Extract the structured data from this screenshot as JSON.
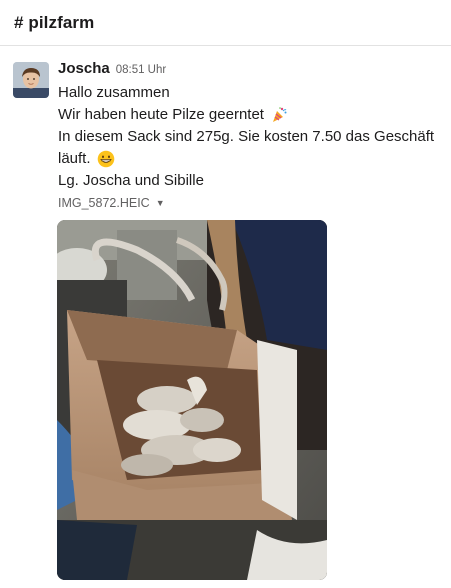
{
  "channel": {
    "title": "# pilzfarm"
  },
  "message": {
    "sender": "Joscha",
    "timestamp": "08:51 Uhr",
    "lines": [
      "Hallo zusammen",
      "Wir haben heute Pilze geerntet",
      "In diesem Sack sind 275g. Sie kosten 7.50 das Geschäft",
      "läuft.",
      "Lg. Joscha und Sibille"
    ],
    "emojis": [
      "party-popper-icon",
      "grinning-face-icon"
    ],
    "attachment": {
      "filename": "IMG_5872.HEIC"
    }
  }
}
